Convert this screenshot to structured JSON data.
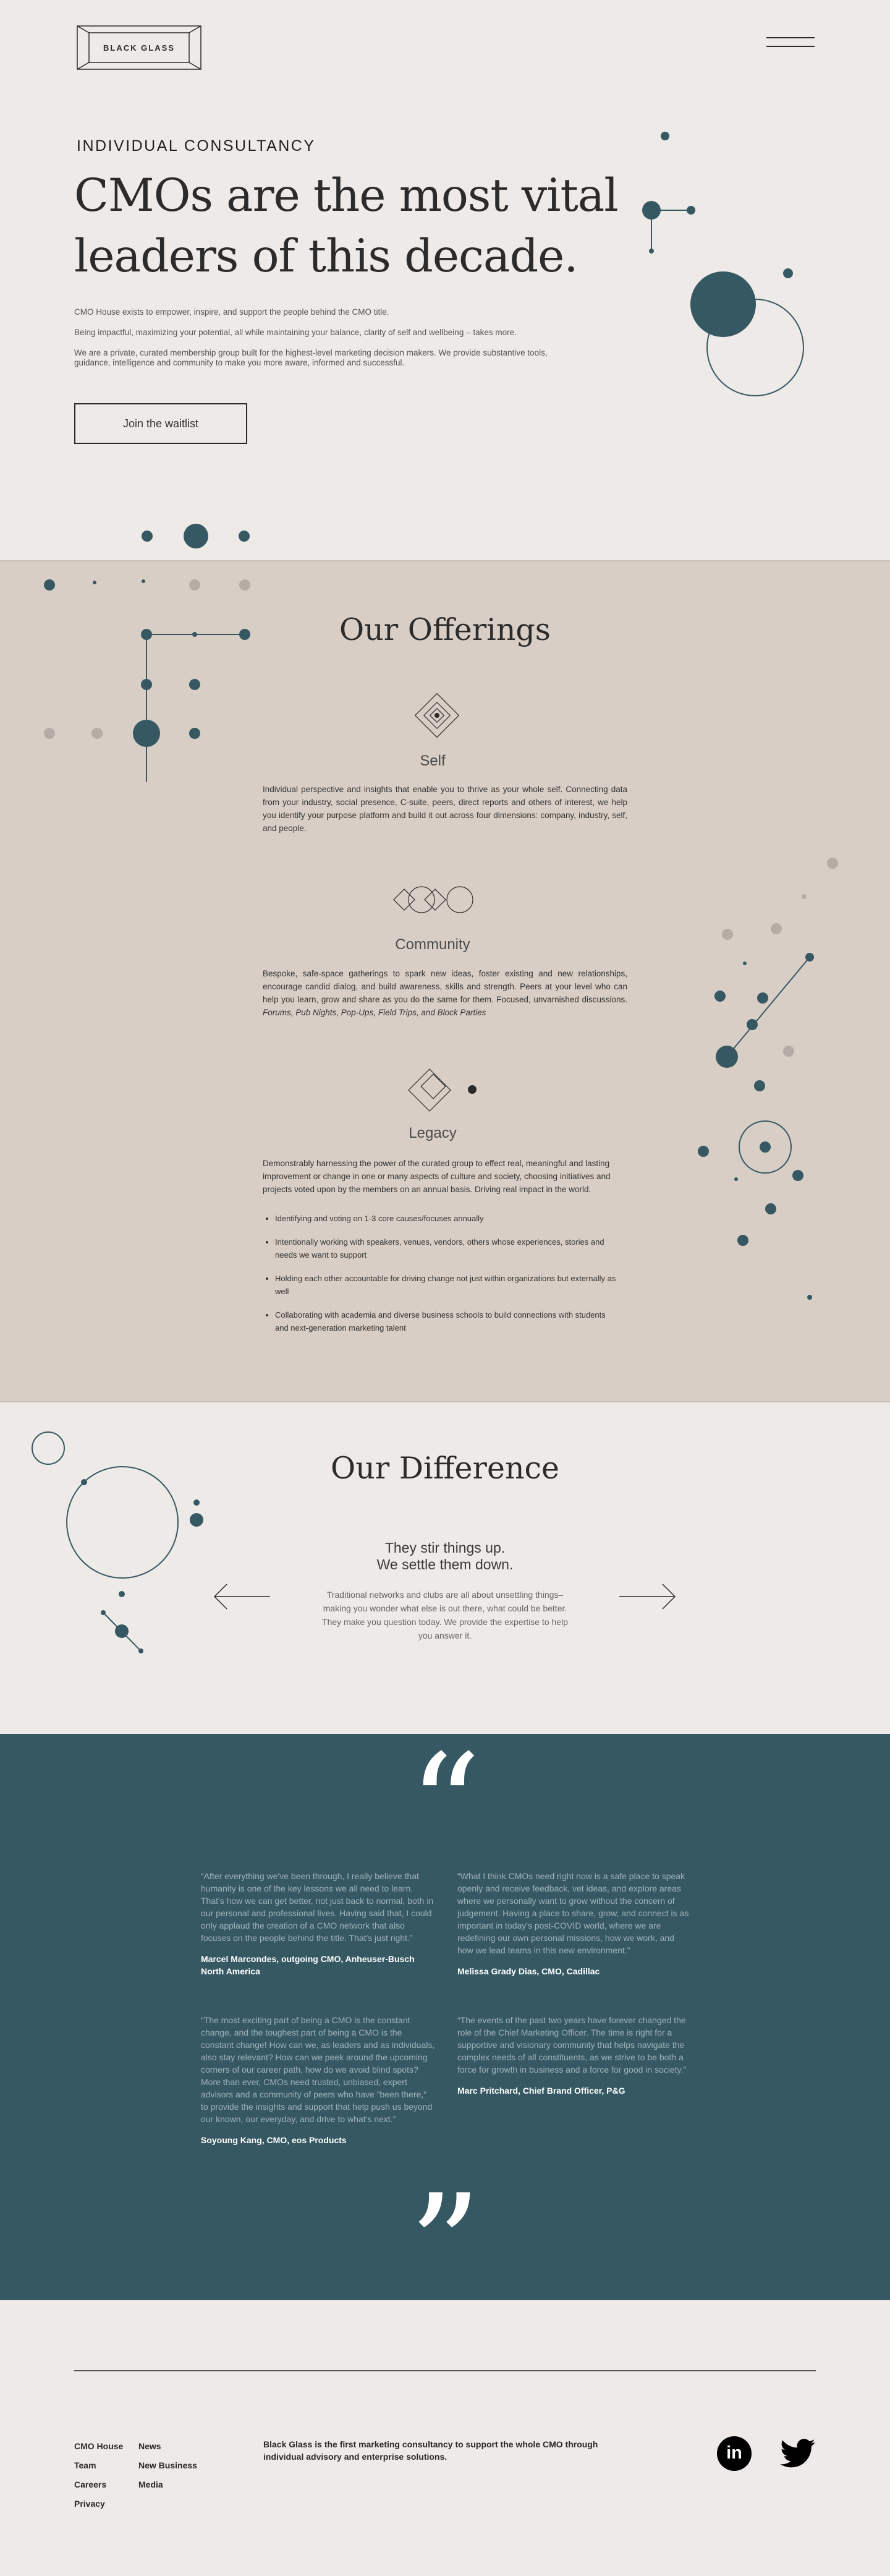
{
  "header": {
    "logo": "BLACK GLASS",
    "menu_icon": "hamburger-icon"
  },
  "hero": {
    "eyebrow": "INDIVIDUAL CONSULTANCY",
    "title_line1": "CMOs are the most vital",
    "title_line2": "leaders of this decade.",
    "p1": "CMO House exists to empower, inspire, and support the people behind the CMO title.",
    "p2": "Being impactful, maximizing your potential, all while maintaining your balance, clarity of self and wellbeing – takes more.",
    "p3": "We are a private, curated membership group built for the highest-level marketing decision makers. We provide substantive tools, guidance, intelligence and community to make you more aware, informed and successful.",
    "cta": "Join the waitlist"
  },
  "offerings": {
    "title": "Our Offerings",
    "self": {
      "heading": "Self",
      "icon": "diamond-icon",
      "body": "Individual perspective and insights that enable you to thrive as your whole self. Connecting data from your industry, social presence, C-suite, peers, direct reports and others of interest, we help you identify your purpose platform and build it out across four dimensions: company, industry, self, and people."
    },
    "community": {
      "heading": "Community",
      "icon": "linked-circles-icon",
      "body_main": "Bespoke, safe-space gatherings to spark new ideas, foster existing and new relationships, encourage candid dialog, and build awareness, skills and strength. Peers at your level who can help you learn, grow and share as you do the same for them. Focused, unvarnished discussions.",
      "body_italic": "Forums, Pub Nights, Pop-Ups, Field Trips, and Block Parties"
    },
    "legacy": {
      "heading": "Legacy",
      "icon": "diamond-dot-icon",
      "body": "Demonstrably harnessing the power of the curated group to effect real, meaningful and lasting improvement or change in one or many aspects of culture and society, choosing initiatives and projects voted upon by the members on an annual basis. Driving real impact in the world.",
      "bullets": [
        "Identifying and voting on 1-3 core causes/focuses annually",
        "Intentionally working with speakers, venues, vendors, others whose experiences, stories and needs we want to support",
        "Holding each other accountable for driving change not just within organizations but externally as well",
        "Collaborating with academia and diverse business schools to build connections with students and next-generation marketing talent"
      ]
    }
  },
  "difference": {
    "title": "Our Difference",
    "sub1": "They stir things up.",
    "sub2": "We settle them down.",
    "body": "Traditional networks and clubs are all about unsettling things–making you wonder what else is out there, what could be better. They make you question today. We provide the expertise to help you answer it.",
    "prev_icon": "arrow-left-icon",
    "next_icon": "arrow-right-icon"
  },
  "testimonials": {
    "open_quote": "“",
    "close_quote": "”",
    "items": [
      {
        "text": "“After everything we've been through, I really believe that humanity is one of the key lessons we all need to learn. That's how we can get better, not just back to normal, both in our personal and professional lives. Having said that, I could only applaud the creation of a CMO network that also focuses on the people behind the title. That's just right.”",
        "name": "Marcel Marcondes, outgoing CMO, Anheuser-Busch North America"
      },
      {
        "text": "“What I think CMOs need right now is a safe place to speak openly and receive feedback, vet ideas, and explore areas where we personally want to grow without the concern of judgement. Having a place to share, grow, and connect is as important in today's post-COVID world, where we are redefining our own personal missions, how we work, and how we lead teams in this new environment.”",
        "name": "Melissa Grady Dias, CMO, Cadillac"
      },
      {
        "text": "“The most exciting part of being a CMO is the constant change, and the toughest part of being a CMO is the constant change! How can we, as leaders and as individuals, also stay relevant? How can we peek around the upcoming corners of our career path, how do we avoid blind spots? More than ever, CMOs need trusted, unbiased, expert advisors and a community of peers who have “been there,” to provide the insights and support that help push us beyond our known, our everyday, and drive to what's next.”",
        "name": "Soyoung Kang, CMO, eos Products"
      },
      {
        "text": "“The events of the past two years have forever changed the role of the Chief Marketing Officer. The time is right for a supportive and visionary community that helps navigate the complex needs of all constituents, as we strive to be both a force for growth in business and a force for good in society.”",
        "name": "Marc Pritchard, Chief Brand Officer, P&G"
      }
    ]
  },
  "footer": {
    "col1": [
      "CMO House",
      "Team",
      "Careers",
      "Privacy"
    ],
    "col2": [
      "News",
      "New Business",
      "Media"
    ],
    "tagline": "Black Glass is the first marketing consultancy to support the whole CMO through individual advisory and enterprise solutions.",
    "linkedin_label": "in",
    "linkedin_icon": "linkedin-icon",
    "twitter_icon": "twitter-icon"
  },
  "colors": {
    "accent": "#365862",
    "background": "#eeeae7",
    "offerings_bg": "#d9cec5"
  }
}
